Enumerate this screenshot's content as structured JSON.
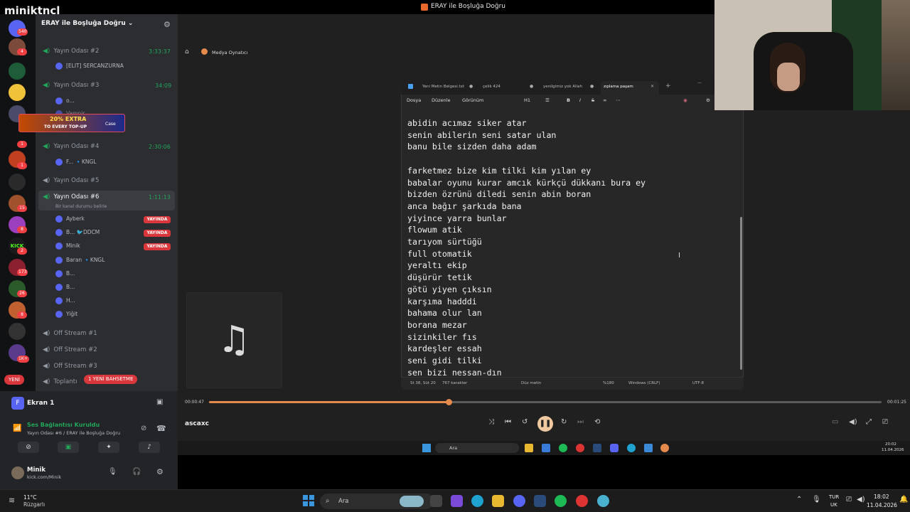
{
  "stream": {
    "channel": "miniktncl",
    "window_title": "ERAY ile Boşluğa Doğru"
  },
  "servers": {
    "badges": [
      "540",
      "4",
      "1",
      "1",
      "15",
      "8",
      "2",
      "173",
      "26",
      "8",
      "1K+"
    ],
    "new_label": "YENİ"
  },
  "sidebar": {
    "guild": "ERAY ile Boşluğa Doğru",
    "channels": [
      {
        "name": "Yayın Odası #2",
        "time": "3:33:37"
      },
      {
        "name": "Yayın Odası #3",
        "time": "34:09"
      },
      {
        "name": "Yayın Odası #4",
        "time": "2:30:06"
      },
      {
        "name": "Yayın Odası #5",
        "time": ""
      },
      {
        "name": "Yayın Odası #6",
        "time": "1:11:13"
      }
    ],
    "members_room2": [
      "[ELIT] SERCANZURNA"
    ],
    "members_room3": [
      "o...",
      "Vampir..."
    ],
    "members_room4": [
      "F... 🔹KNGL"
    ],
    "status_placeholder": "Bir kanal durumu belirle",
    "members_room6": [
      {
        "name": "Ayberk",
        "live": true
      },
      {
        "name": "B... 🐦DDCM",
        "live": true
      },
      {
        "name": "Minik",
        "live": true
      },
      {
        "name": "Baran 🔹KNGL",
        "live": false
      },
      {
        "name": "B...",
        "live": false
      },
      {
        "name": "B...",
        "live": false
      },
      {
        "name": "H...",
        "live": false
      },
      {
        "name": "Yiğit",
        "live": false
      }
    ],
    "live_label": "YAYINDA",
    "off_channels": [
      "Off Stream #1",
      "Off Stream #2",
      "Off Stream #3",
      "Toplantı"
    ],
    "new_bet_badge": "1 YENİ BAHSETME",
    "promo": {
      "title": "20% EXTRA",
      "subtitle": "TO EVERY TOP-UP",
      "brand": "Case"
    }
  },
  "panel": {
    "screen_share": "Ekran 1",
    "screen_avatar": "F",
    "voice_status": "Ses Bağlantısı Kuruldu",
    "voice_channel": "Yayın Odası #6 / ERAY ile Boşluğa Doğru",
    "user_name": "Minik",
    "user_sub": "kick.com/Minik"
  },
  "player": {
    "title": "Medya Oynatıcı",
    "track": "ascaxc",
    "time_current": "00:00:47",
    "time_total": "00:01:25",
    "progress": 0.356
  },
  "notepad": {
    "tabs": [
      "Yeni Metin Belgesi.txt",
      "çelik 424",
      "yenilgimiz yok Allah",
      "zıplama paşam"
    ],
    "menus": [
      "Dosya",
      "Düzenle",
      "Görünüm"
    ],
    "heading_ctl": "H1",
    "lines": [
      "abidin acımaz siker atar",
      "senin abilerin seni satar ulan",
      "banu bile sizden daha adam",
      "",
      "farketmez bize kim tilki kim yılan ey",
      "babalar oyunu kurar amcık kürkçü dükkanı bura ey",
      "bizden özrünü diledi senin abin boran",
      "anca bağır şarkıda bana",
      "yiyince yarra bunlar",
      "flowum atik",
      "tarıyom sürtüğü",
      "full otomatik",
      "yeraltı ekip",
      "düşürür tetik",
      "götü yiyen çıksın",
      "karşıma hadddi",
      "bahama olur lan",
      "borana mezar",
      "sizinkiler fıs",
      "kardeşler essah",
      "seni gidi tilki",
      "sen bizi nessan-dın"
    ],
    "status": {
      "position": "St 38, Süt 20",
      "chars": "767 karakter",
      "mode": "Düz metin",
      "zoom": "%180",
      "eol": "Windows (CRLF)",
      "encoding": "UTF-8"
    }
  },
  "inner_taskbar": {
    "search": "Ara",
    "time": "20:02",
    "date": "11.04.2026"
  },
  "taskbar": {
    "weather_temp": "11°C",
    "weather_desc": "Rüzgarlı",
    "search": "Ara",
    "lang1": "TUR",
    "lang2": "UK",
    "time": "18:02",
    "date": "11.04.2026"
  }
}
